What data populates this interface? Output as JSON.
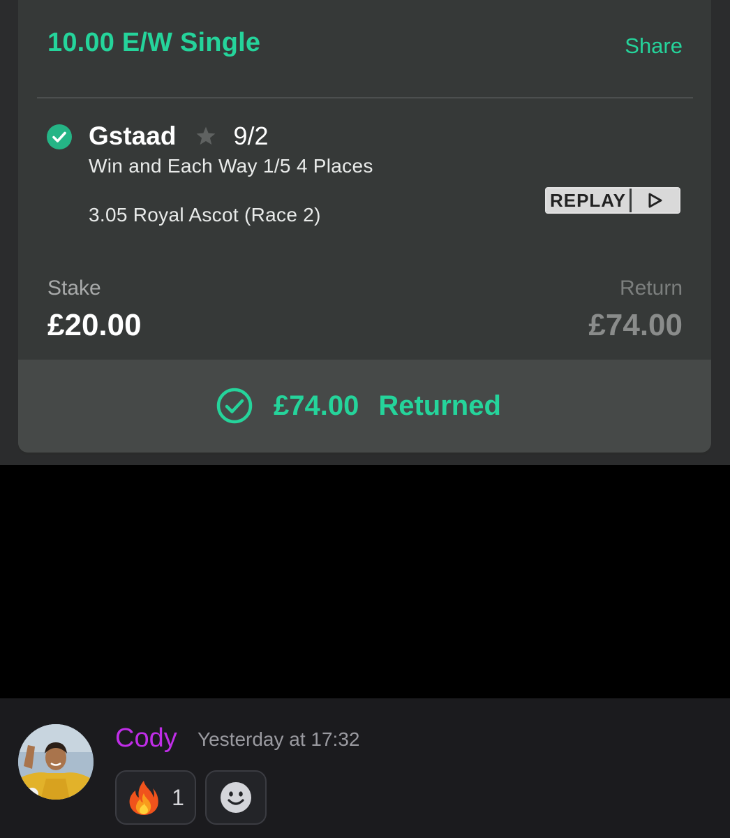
{
  "bet": {
    "title": "10.00 E/W Single",
    "share_label": "Share",
    "selection_name": "Gstaad",
    "odds": "9/2",
    "terms": "Win and Each Way 1/5 4 Places",
    "race": "3.05 Royal Ascot (Race 2)",
    "replay_label": "REPLAY",
    "stake_label": "Stake",
    "stake_value": "£20.00",
    "return_label": "Return",
    "return_value": "£74.00",
    "returned_amount": "£74.00",
    "returned_text": "Returned",
    "accent_color": "#25d49b",
    "status": "won",
    "icons": [
      "check-circle-icon",
      "star-icon",
      "play-icon",
      "returned-check-icon"
    ]
  },
  "message": {
    "author": "Cody",
    "author_color": "#c02de8",
    "timestamp": "Yesterday at 17:32",
    "reactions": [
      {
        "emoji": "fire-emoji-icon",
        "count": "1"
      }
    ],
    "add_reaction_icon": "smiley-icon"
  }
}
